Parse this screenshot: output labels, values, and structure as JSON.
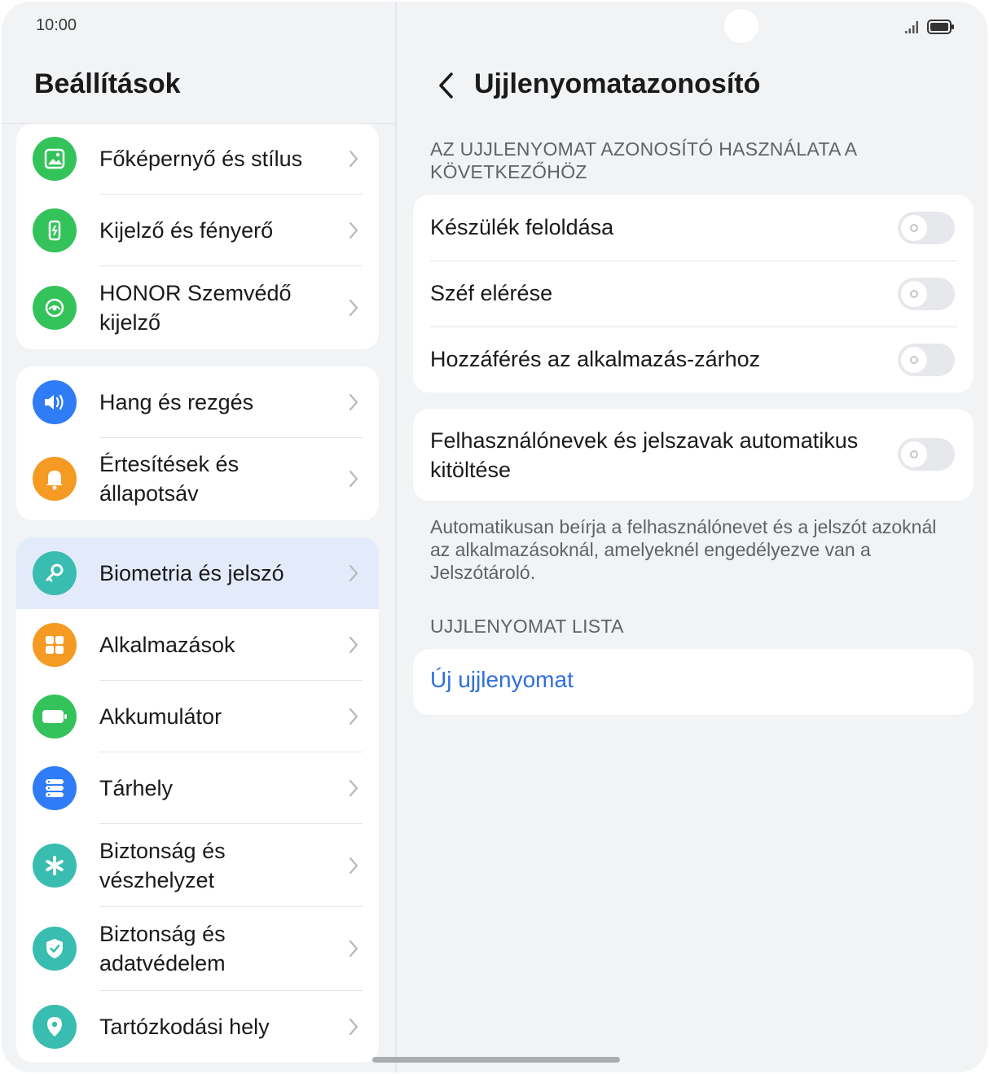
{
  "status_bar": {
    "time": "10:00",
    "signal_icon": "signal-icon",
    "battery_icon": "battery-icon"
  },
  "left": {
    "title": "Beállítások",
    "groups": [
      [
        {
          "label": "Főképernyő és stílus",
          "icon": "home-screen-icon",
          "color": "#34c25a"
        },
        {
          "label": "Kijelző és fényerő",
          "icon": "display-icon",
          "color": "#34c25a"
        },
        {
          "label": "HONOR Szemvédő kijelző",
          "icon": "eye-comfort-icon",
          "color": "#34c25a"
        }
      ],
      [
        {
          "label": "Hang és rezgés",
          "icon": "sound-icon",
          "color": "#2f7cf6"
        },
        {
          "label": "Értesítések és állapotsáv",
          "icon": "bell-icon",
          "color": "#f59a23"
        }
      ],
      [
        {
          "label": "Biometria és jelszó",
          "icon": "key-icon",
          "color": "#38bdb0",
          "selected": true
        },
        {
          "label": "Alkalmazások",
          "icon": "apps-icon",
          "color": "#f59a23"
        },
        {
          "label": "Akkumulátor",
          "icon": "battery-setting-icon",
          "color": "#34c25a"
        },
        {
          "label": "Tárhely",
          "icon": "storage-icon",
          "color": "#2f7cf6"
        },
        {
          "label": "Biztonság és vészhelyzet",
          "icon": "emergency-icon",
          "color": "#38bdb0"
        },
        {
          "label": "Biztonság és adatvédelem",
          "icon": "shield-icon",
          "color": "#38bdb0"
        },
        {
          "label": "Tartózkodási hely",
          "icon": "location-icon",
          "color": "#38bdb0"
        }
      ]
    ]
  },
  "right": {
    "title": "Ujjlenyomatazonosító",
    "section1_header": "AZ UJJLENYOMAT AZONOSÍTÓ HASZNÁLATA A KÖVETKEZŐHÖZ",
    "toggles": [
      {
        "label": "Készülék feloldása",
        "on": false
      },
      {
        "label": "Széf elérése",
        "on": false
      },
      {
        "label": "Hozzáférés az alkalmazás-zárhoz",
        "on": false
      }
    ],
    "autofill": {
      "label": "Felhasználónevek és jelszavak automatikus kitöltése",
      "on": false
    },
    "autofill_desc": "Automatikusan beírja a felhasználónevet és a jelszót azoknál az alkalmazásoknál, amelyeknél engedélyezve van a Jelszótároló.",
    "section2_header": "UJJLENYOMAT LISTA",
    "new_fingerprint": "Új ujjlenyomat",
    "accent_color": "#2f6fdc"
  }
}
